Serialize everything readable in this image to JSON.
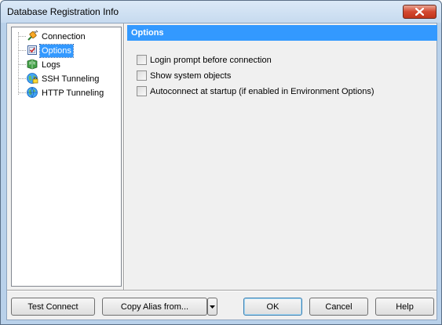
{
  "window": {
    "title": "Database Registration Info"
  },
  "tree": {
    "items": [
      {
        "label": "Connection",
        "icon": "connection-plug-icon",
        "selected": false
      },
      {
        "label": "Options",
        "icon": "options-checklist-icon",
        "selected": true
      },
      {
        "label": "Logs",
        "icon": "logs-book-icon",
        "selected": false
      },
      {
        "label": "SSH Tunneling",
        "icon": "ssh-globe-icon",
        "selected": false
      },
      {
        "label": "HTTP Tunneling",
        "icon": "http-globe-icon",
        "selected": false
      }
    ]
  },
  "panel": {
    "header": "Options",
    "options": [
      {
        "label": "Login prompt before connection",
        "checked": false
      },
      {
        "label": "Show system objects",
        "checked": false
      },
      {
        "label": "Autoconnect at startup (if enabled in Environment Options)",
        "checked": false
      }
    ]
  },
  "buttons": {
    "test_connect": "Test Connect",
    "copy_alias": "Copy Alias from...",
    "ok": "OK",
    "cancel": "Cancel",
    "help": "Help"
  },
  "colors": {
    "selection": "#3399ff",
    "header_bg": "#3399ff",
    "close_button": "#c1361c"
  }
}
